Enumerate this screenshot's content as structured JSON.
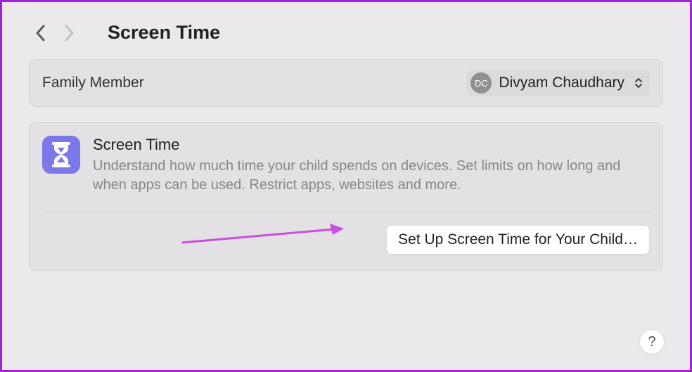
{
  "header": {
    "title": "Screen Time"
  },
  "family": {
    "label": "Family Member",
    "member_initials": "DC",
    "member_name": "Divyam Chaudhary"
  },
  "screen_time": {
    "title": "Screen Time",
    "description": "Understand how much time your child spends on devices. Set limits on how long and when apps can be used. Restrict apps, websites and more.",
    "setup_button": "Set Up Screen Time for Your Child…"
  },
  "help": {
    "label": "?"
  }
}
